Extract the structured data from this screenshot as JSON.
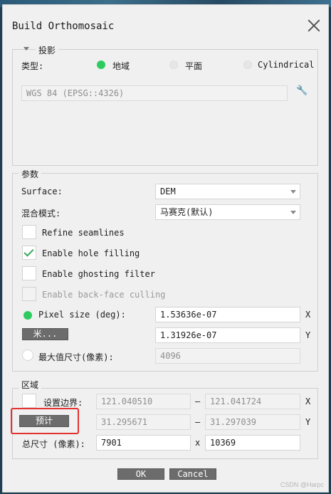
{
  "dialog": {
    "title": "Build Orthomosaic"
  },
  "projection": {
    "section_label": "投影",
    "type_label": "类型:",
    "options": [
      "地域",
      "平面",
      "Cylindrical"
    ],
    "selected": "地域",
    "crs_value": "WGS 84 (EPSG::4326)",
    "tool_icon": "wrench-icon"
  },
  "parameters": {
    "section_label": "参数",
    "surface_label": "Surface:",
    "surface_value": "DEM",
    "blend_label": "混合模式:",
    "blend_value": "马赛克(默认)",
    "checkboxes": [
      {
        "label": "Refine seamlines",
        "checked": false,
        "enabled": true
      },
      {
        "label": "Enable hole filling",
        "checked": true,
        "enabled": true
      },
      {
        "label": "Enable ghosting filter",
        "checked": false,
        "enabled": true
      },
      {
        "label": "Enable back-face culling",
        "checked": false,
        "enabled": false
      }
    ],
    "pixel_size_label": "Pixel size (deg):",
    "pixel_x": "1.53636e-07",
    "pixel_y": "1.31926e-07",
    "meters_button": "米...",
    "max_size_label": "最大值尺寸(像素):",
    "max_size_value": "4096",
    "axis_x": "X",
    "axis_y": "Y"
  },
  "region": {
    "section_label": "区域",
    "set_bounds_label": "设置边界:",
    "x_min": "121.040510",
    "x_max": "121.041724",
    "y_min": "31.295671",
    "y_max": "31.297039",
    "dash": "–",
    "estimate_button": "预计",
    "total_size_label": "总尺寸 (像素):",
    "width": "7901",
    "times": "x",
    "height": "10369",
    "axis_x": "X",
    "axis_y": "Y"
  },
  "footer": {
    "ok_label": "OK",
    "cancel_label": "Cancel"
  },
  "watermark": "CSDN @Harpc",
  "colors": {
    "accent_green": "#2ecc60",
    "highlight_red": "#e53030"
  }
}
